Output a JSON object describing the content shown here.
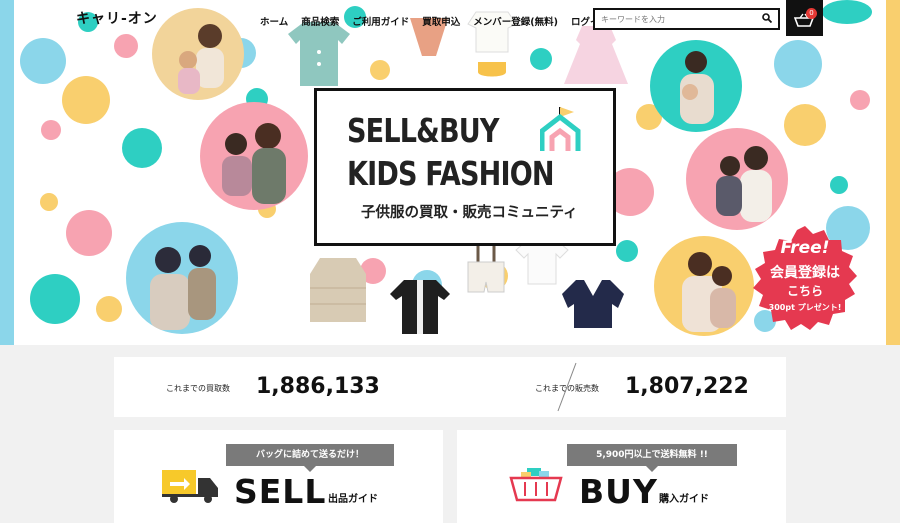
{
  "header": {
    "logo_text": "キャリ-オン",
    "nav": [
      "ホーム",
      "商品検索",
      "ご利用ガイド",
      "買取申込",
      "メンバー登録(無料)",
      "ログイン"
    ],
    "search_placeholder": "キーワードを入力",
    "cart_count": "0"
  },
  "hero": {
    "title_line1": "SELL&BUY",
    "title_line2": "KIDS FASHION",
    "subtitle": "子供服の買取・販売コミュニティ",
    "promo": {
      "free": "Free!",
      "line1": "会員登録は",
      "line2": "こちら",
      "line3": "300pt プレゼント!"
    }
  },
  "stats": {
    "purchase_label": "これまでの買取数",
    "purchase_value": "1,886,133",
    "sales_label": "これまでの販売数",
    "sales_value": "1,807,222"
  },
  "cards": {
    "sell": {
      "tag": "バッグに詰めて送るだけ！",
      "title": "SELL",
      "subtitle": "出品ガイド"
    },
    "buy": {
      "tag": "5,900円以上で送料無料 !!",
      "title": "BUY",
      "subtitle": "購入ガイド"
    }
  },
  "colors": {
    "yellow": "#f9cf6e",
    "teal": "#2ecfc2",
    "pink": "#f7a3b1",
    "sky": "#8bd6ea",
    "promo_red": "#e53950"
  }
}
